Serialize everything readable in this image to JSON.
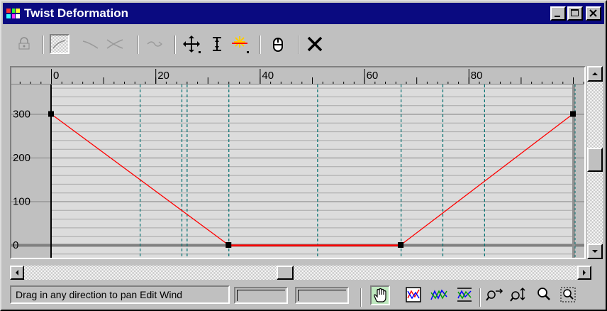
{
  "window": {
    "title": "Twist Deformation"
  },
  "toolbar": {
    "tools": [
      {
        "name": "lock-icon",
        "state": "disabled"
      },
      {
        "name": "linear-curve-icon",
        "state": "pressed"
      },
      {
        "name": "falloff-curve-icon",
        "state": "disabled"
      },
      {
        "name": "crossed-curves-icon",
        "state": "disabled"
      },
      {
        "name": "swap-deform-curves-icon",
        "state": "disabled"
      },
      {
        "name": "move-control-point-icon",
        "state": "normal"
      },
      {
        "name": "scale-control-point-icon",
        "state": "normal"
      },
      {
        "name": "insert-corner-point-icon",
        "state": "normal"
      },
      {
        "name": "reset-curve-icon",
        "state": "normal"
      },
      {
        "name": "delete-control-point-icon",
        "state": "normal"
      }
    ]
  },
  "graph": {
    "x_ticks": [
      "0",
      "20",
      "40",
      "60",
      "80"
    ],
    "y_ticks": [
      "300",
      "200",
      "100",
      "0"
    ],
    "curve_color": "#ff0000",
    "points": [
      {
        "x": 0,
        "y": 300
      },
      {
        "x": 34,
        "y": 0
      },
      {
        "x": 67,
        "y": 0
      },
      {
        "x": 100,
        "y": 300
      }
    ]
  },
  "status": {
    "prompt": "Drag in any direction to pan Edit Wind",
    "field1": "",
    "field2": ""
  },
  "navtools": [
    {
      "name": "pan-hand-icon",
      "state": "pressed"
    },
    {
      "name": "zoom-extents-icon"
    },
    {
      "name": "zoom-horizontal-extents-icon"
    },
    {
      "name": "zoom-vertical-extents-icon"
    },
    {
      "name": "zoom-horizontal-icon"
    },
    {
      "name": "zoom-vertical-icon"
    },
    {
      "name": "zoom-icon"
    },
    {
      "name": "zoom-region-icon"
    }
  ]
}
